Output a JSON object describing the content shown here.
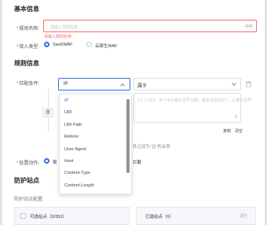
{
  "basic": {
    "title": "基本信息",
    "rule_name_label": "规则名称:",
    "rule_name_placeholder": "请输入规则名称",
    "rule_name_count": "0/40",
    "rule_name_error": "请输入规则名称",
    "access_type_label": "接入类型:",
    "access_options": [
      {
        "label": "SaaSWAF",
        "selected": true
      },
      {
        "label": "云原生WAF",
        "selected": false
      }
    ]
  },
  "rule": {
    "title": "规则信息",
    "match_label": "匹配条件:",
    "field_value": "IP",
    "operator_value": "属于",
    "and_label": "且",
    "value_placeholder": "1.1.1.1/24，多个IP以英文逗号分隔，最多添加200个，以英文逗号",
    "value_count": "0",
    "copy_label": "复制",
    "clear_label": "清空",
    "relation_note": "件之间为\"且\"的关系",
    "action_label": "处置动作:",
    "action_option": "观",
    "action_option2": "拦截",
    "dropdown_options": [
      "IP",
      "URI",
      "URI Path",
      "Referer",
      "User-Agent",
      "Host",
      "Content-Type",
      "Content-Length"
    ],
    "dropdown_active": "IP"
  },
  "protect": {
    "title": "防护站点",
    "config_label": "防护站点配置:",
    "available_label": "可选站点（0/353）",
    "selected_label": "已选站点（0）",
    "selected_clear": "清空"
  }
}
